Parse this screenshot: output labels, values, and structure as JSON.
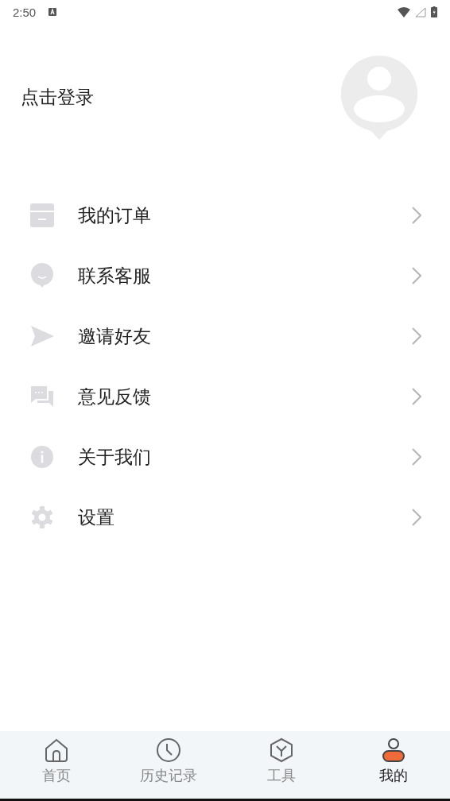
{
  "status_bar": {
    "time": "2:50"
  },
  "header": {
    "login": "点击登录"
  },
  "menu": [
    {
      "kind": "order",
      "label": "我的订单"
    },
    {
      "kind": "service",
      "label": "联系客服"
    },
    {
      "kind": "invite",
      "label": "邀请好友"
    },
    {
      "kind": "feedback",
      "label": "意见反馈"
    },
    {
      "kind": "about",
      "label": "关于我们"
    },
    {
      "kind": "settings",
      "label": "设置"
    }
  ],
  "tabs": [
    {
      "kind": "home",
      "label": "首页",
      "selected": false
    },
    {
      "kind": "history",
      "label": "历史记录",
      "selected": false
    },
    {
      "kind": "tools",
      "label": "工具",
      "selected": false
    },
    {
      "kind": "me",
      "label": "我的",
      "selected": true
    }
  ]
}
